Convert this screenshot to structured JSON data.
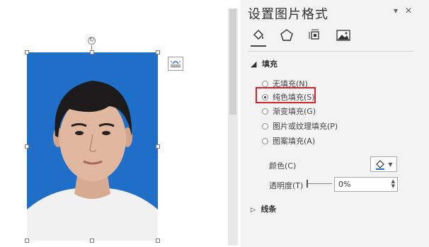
{
  "pane": {
    "title": "设置图片格式",
    "dropdown_glyph": "▾",
    "close_glyph": "✕",
    "tabs": [
      {
        "icon": "fill-bucket-icon"
      },
      {
        "icon": "pentagon-effects-icon"
      },
      {
        "icon": "layout-size-icon"
      },
      {
        "icon": "picture-icon"
      }
    ]
  },
  "fill": {
    "section_label": "填充",
    "options": [
      {
        "label": "无填充(N)",
        "selected": false
      },
      {
        "label": "纯色填充(S)",
        "selected": true
      },
      {
        "label": "渐变填充(G)",
        "selected": false
      },
      {
        "label": "图片或纹理填充(P)",
        "selected": false
      },
      {
        "label": "图案填充(A)",
        "selected": false
      }
    ],
    "color_label": "颜色(C)",
    "transparency_label": "透明度(T)",
    "transparency_value": "0%"
  },
  "line": {
    "section_label": "线条"
  },
  "colors": {
    "accent_highlight": "#d6232a",
    "photo_background": "#1f6fc9"
  }
}
